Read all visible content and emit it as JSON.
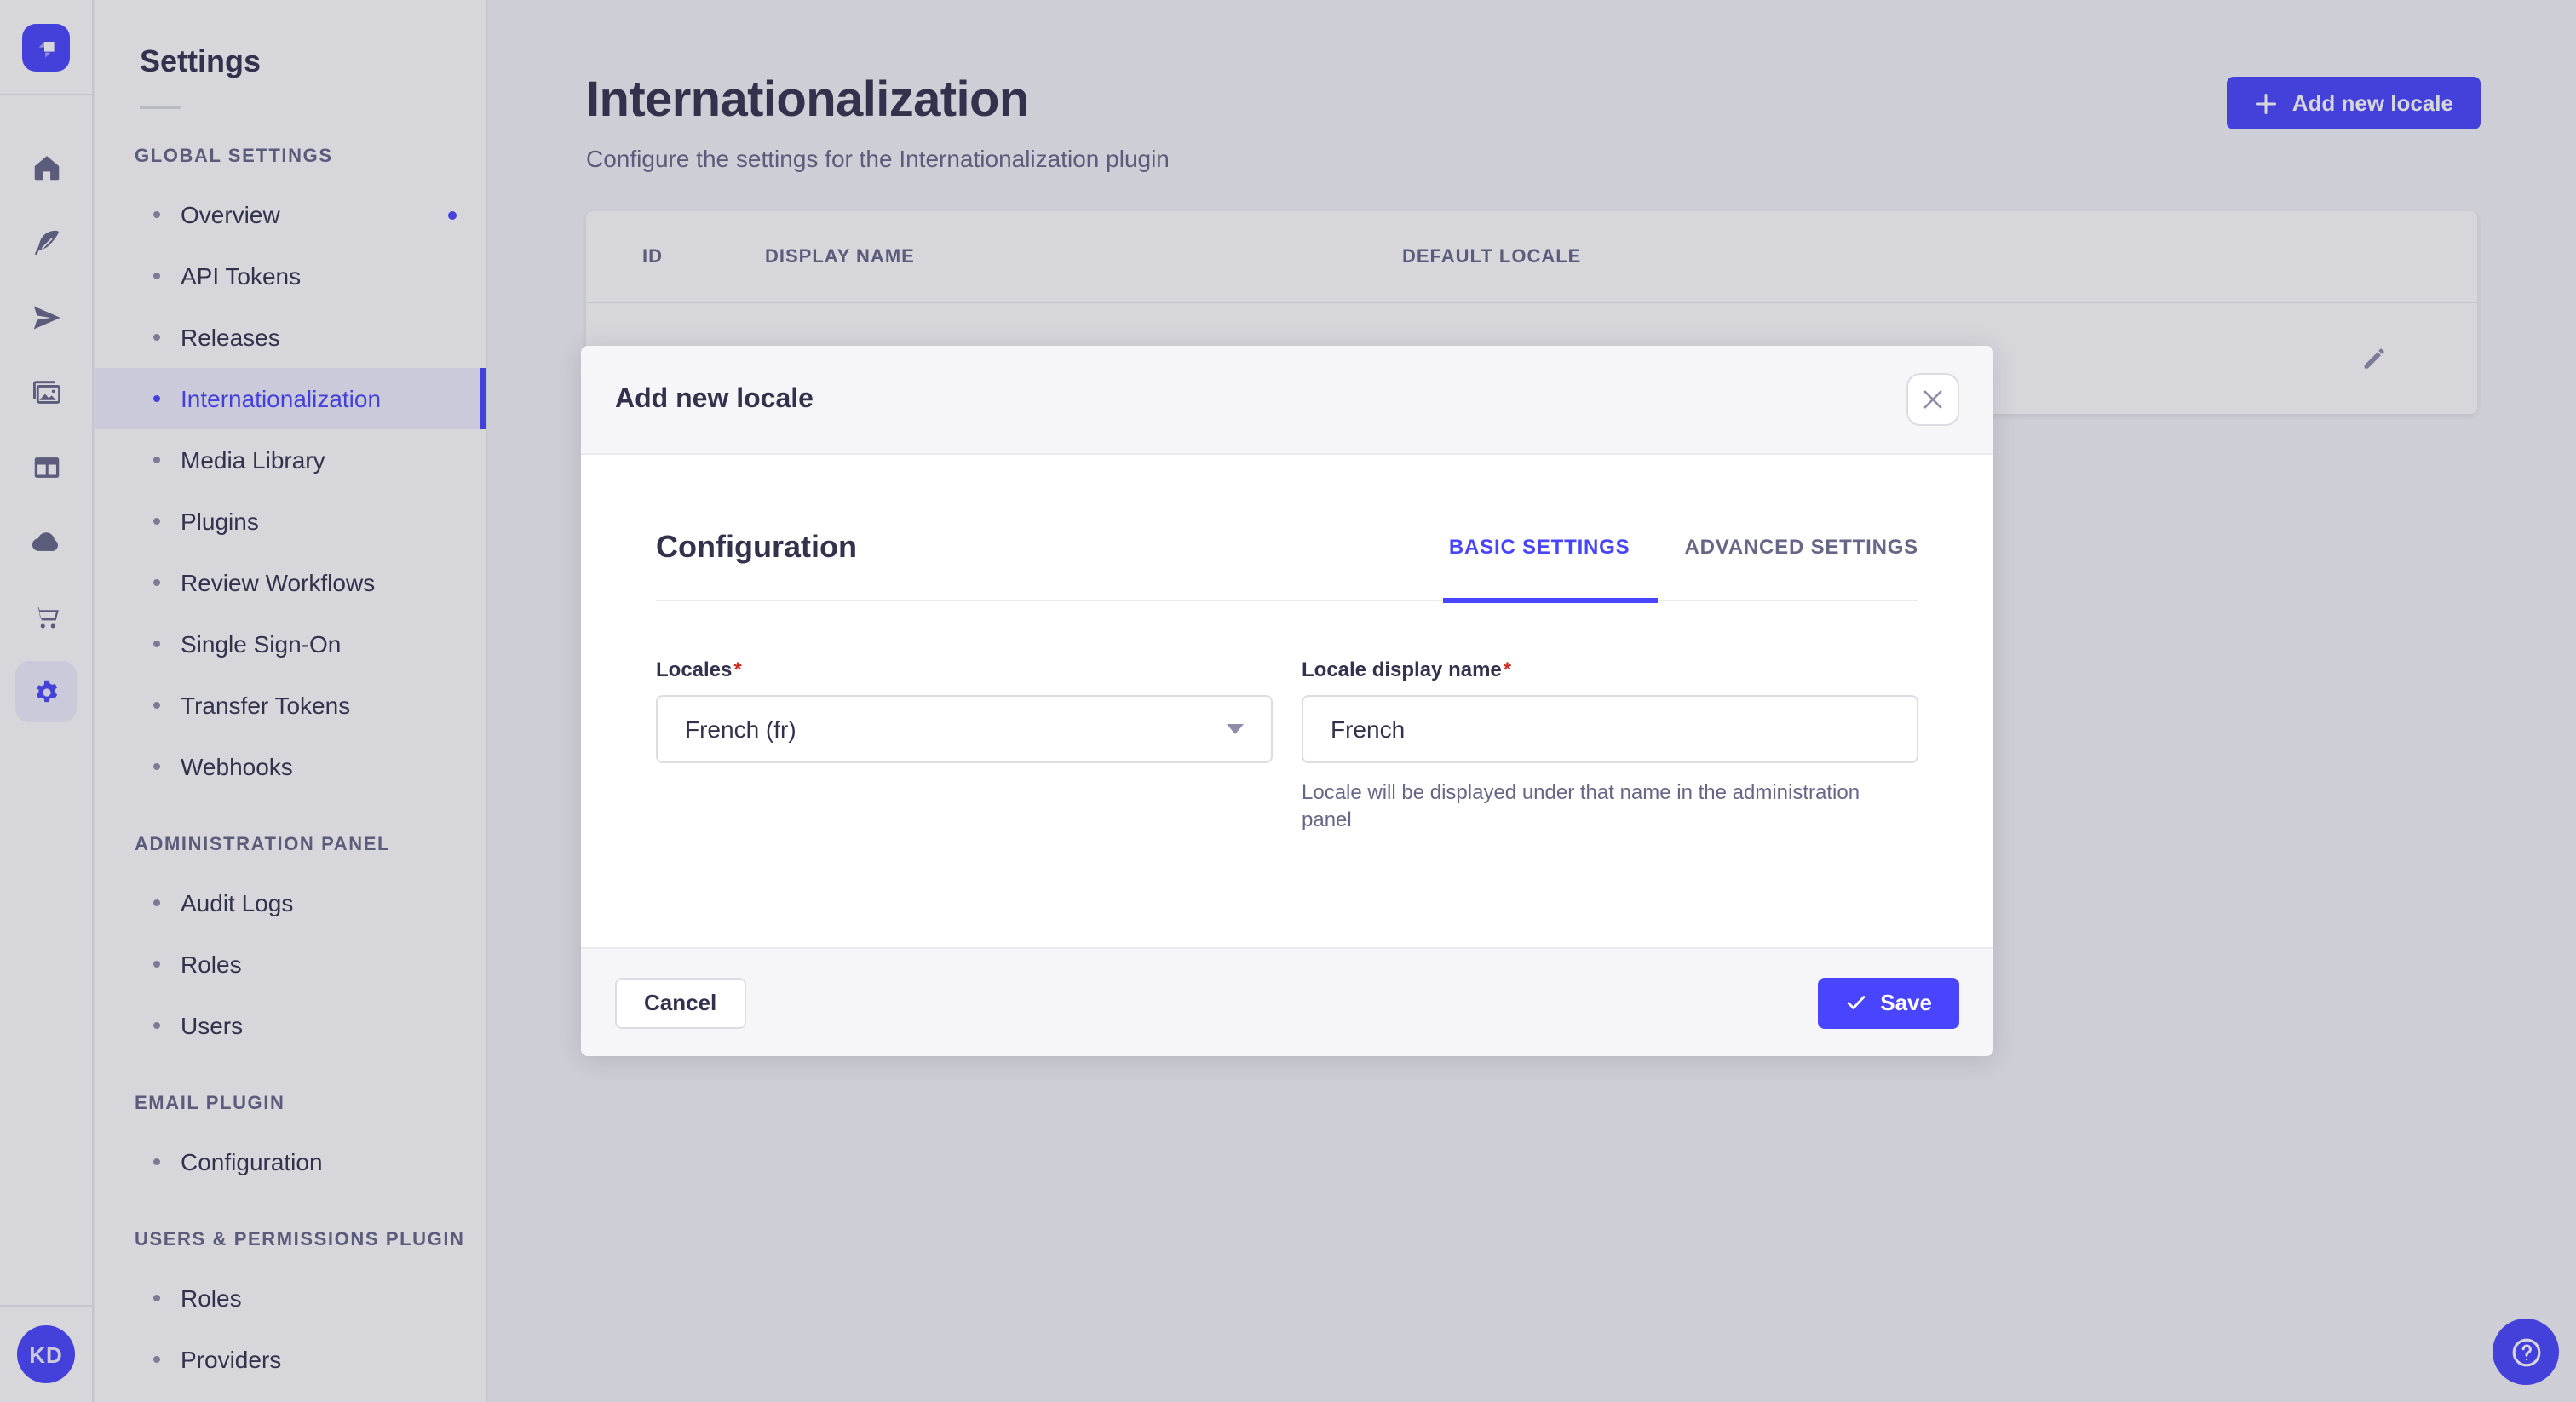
{
  "colors": {
    "primary": "#4945ff",
    "primary_light": "#f0f0ff",
    "text": "#32324d",
    "subtle": "#666687",
    "border": "#dcdce4",
    "bg": "#f6f6f9",
    "danger": "#d02b20",
    "overlay": "rgba(50,50,77,0.2)"
  },
  "icon_rail": {
    "icons": [
      "strapi-logo-icon",
      "home-icon",
      "feather-icon",
      "paper-plane-icon",
      "media-library-icon",
      "layout-icon",
      "cloud-icon",
      "cart-icon",
      "settings-gear-icon"
    ],
    "active_icon": "settings-gear-icon",
    "avatar_initials": "KD"
  },
  "sidebar": {
    "title": "Settings",
    "sections": [
      {
        "header": "GLOBAL SETTINGS",
        "items": [
          {
            "label": "Overview",
            "notification": true
          },
          {
            "label": "API Tokens"
          },
          {
            "label": "Releases"
          },
          {
            "label": "Internationalization",
            "active": true
          },
          {
            "label": "Media Library"
          },
          {
            "label": "Plugins"
          },
          {
            "label": "Review Workflows"
          },
          {
            "label": "Single Sign-On"
          },
          {
            "label": "Transfer Tokens"
          },
          {
            "label": "Webhooks"
          }
        ]
      },
      {
        "header": "ADMINISTRATION PANEL",
        "items": [
          {
            "label": "Audit Logs"
          },
          {
            "label": "Roles"
          },
          {
            "label": "Users"
          }
        ]
      },
      {
        "header": "EMAIL PLUGIN",
        "items": [
          {
            "label": "Configuration"
          }
        ]
      },
      {
        "header": "USERS & PERMISSIONS PLUGIN",
        "items": [
          {
            "label": "Roles"
          },
          {
            "label": "Providers"
          }
        ]
      }
    ]
  },
  "page": {
    "title": "Internationalization",
    "subtitle": "Configure the settings for the Internationalization plugin",
    "add_button_label": "Add new locale"
  },
  "table": {
    "columns": [
      "ID",
      "DISPLAY NAME",
      "DEFAULT LOCALE"
    ]
  },
  "modal": {
    "title": "Add new locale",
    "section_title": "Configuration",
    "tabs": [
      {
        "label": "BASIC SETTINGS",
        "active": true
      },
      {
        "label": "ADVANCED SETTINGS",
        "active": false
      }
    ],
    "fields": {
      "locales": {
        "label": "Locales",
        "required_mark": "*",
        "value": "French (fr)"
      },
      "display_name": {
        "label": "Locale display name",
        "required_mark": "*",
        "value": "French",
        "help": "Locale will be displayed under that name in the administration panel"
      }
    },
    "cancel_label": "Cancel",
    "save_label": "Save"
  }
}
